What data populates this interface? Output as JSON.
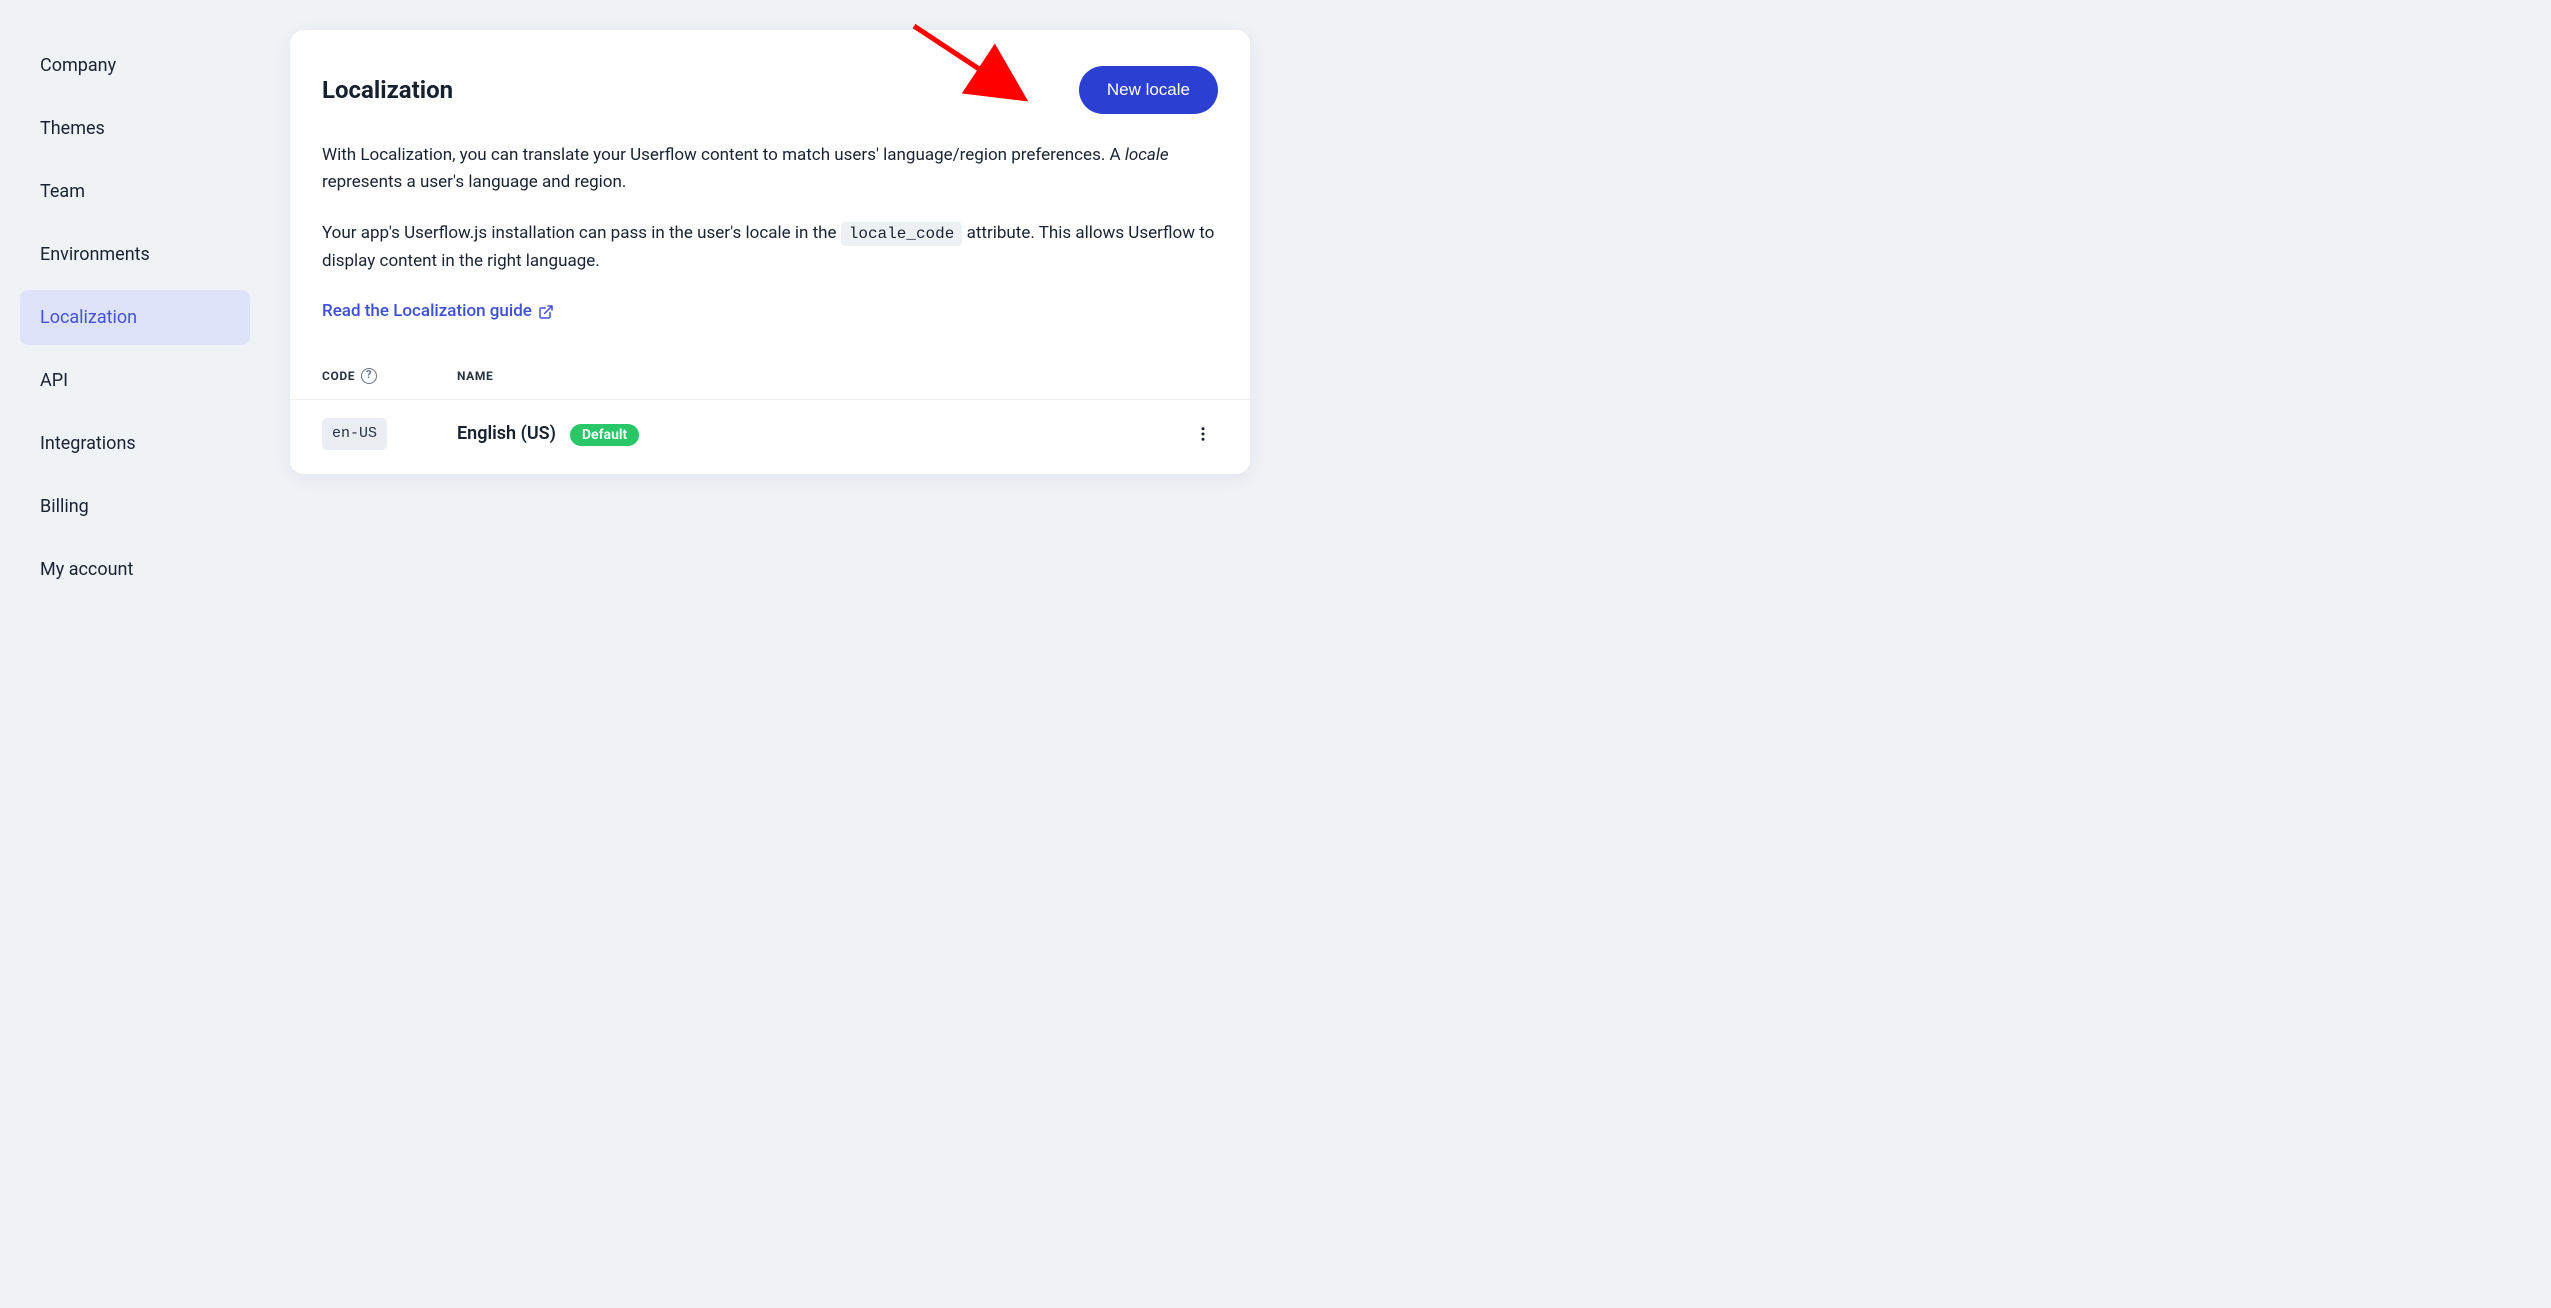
{
  "sidebar": {
    "items": [
      {
        "label": "Company",
        "active": false
      },
      {
        "label": "Themes",
        "active": false
      },
      {
        "label": "Team",
        "active": false
      },
      {
        "label": "Environments",
        "active": false
      },
      {
        "label": "Localization",
        "active": true
      },
      {
        "label": "API",
        "active": false
      },
      {
        "label": "Integrations",
        "active": false
      },
      {
        "label": "Billing",
        "active": false
      },
      {
        "label": "My account",
        "active": false
      }
    ]
  },
  "page": {
    "title": "Localization",
    "new_button_label": "New locale",
    "desc1_pre": "With Localization, you can translate your Userflow content to match users' language/region preferences. A ",
    "desc1_em": "locale",
    "desc1_post": " represents a user's language and region.",
    "desc2_pre": "Your app's Userflow.js installation can pass in the user's locale in the ",
    "desc2_code": "locale_code",
    "desc2_post": " attribute. This allows Userflow to display content in the right language.",
    "guide_link_label": "Read the Localization guide"
  },
  "table": {
    "columns": {
      "code": "CODE",
      "name": "NAME"
    },
    "rows": [
      {
        "code": "en-US",
        "name": "English (US)",
        "default": true,
        "default_label": "Default"
      }
    ]
  }
}
